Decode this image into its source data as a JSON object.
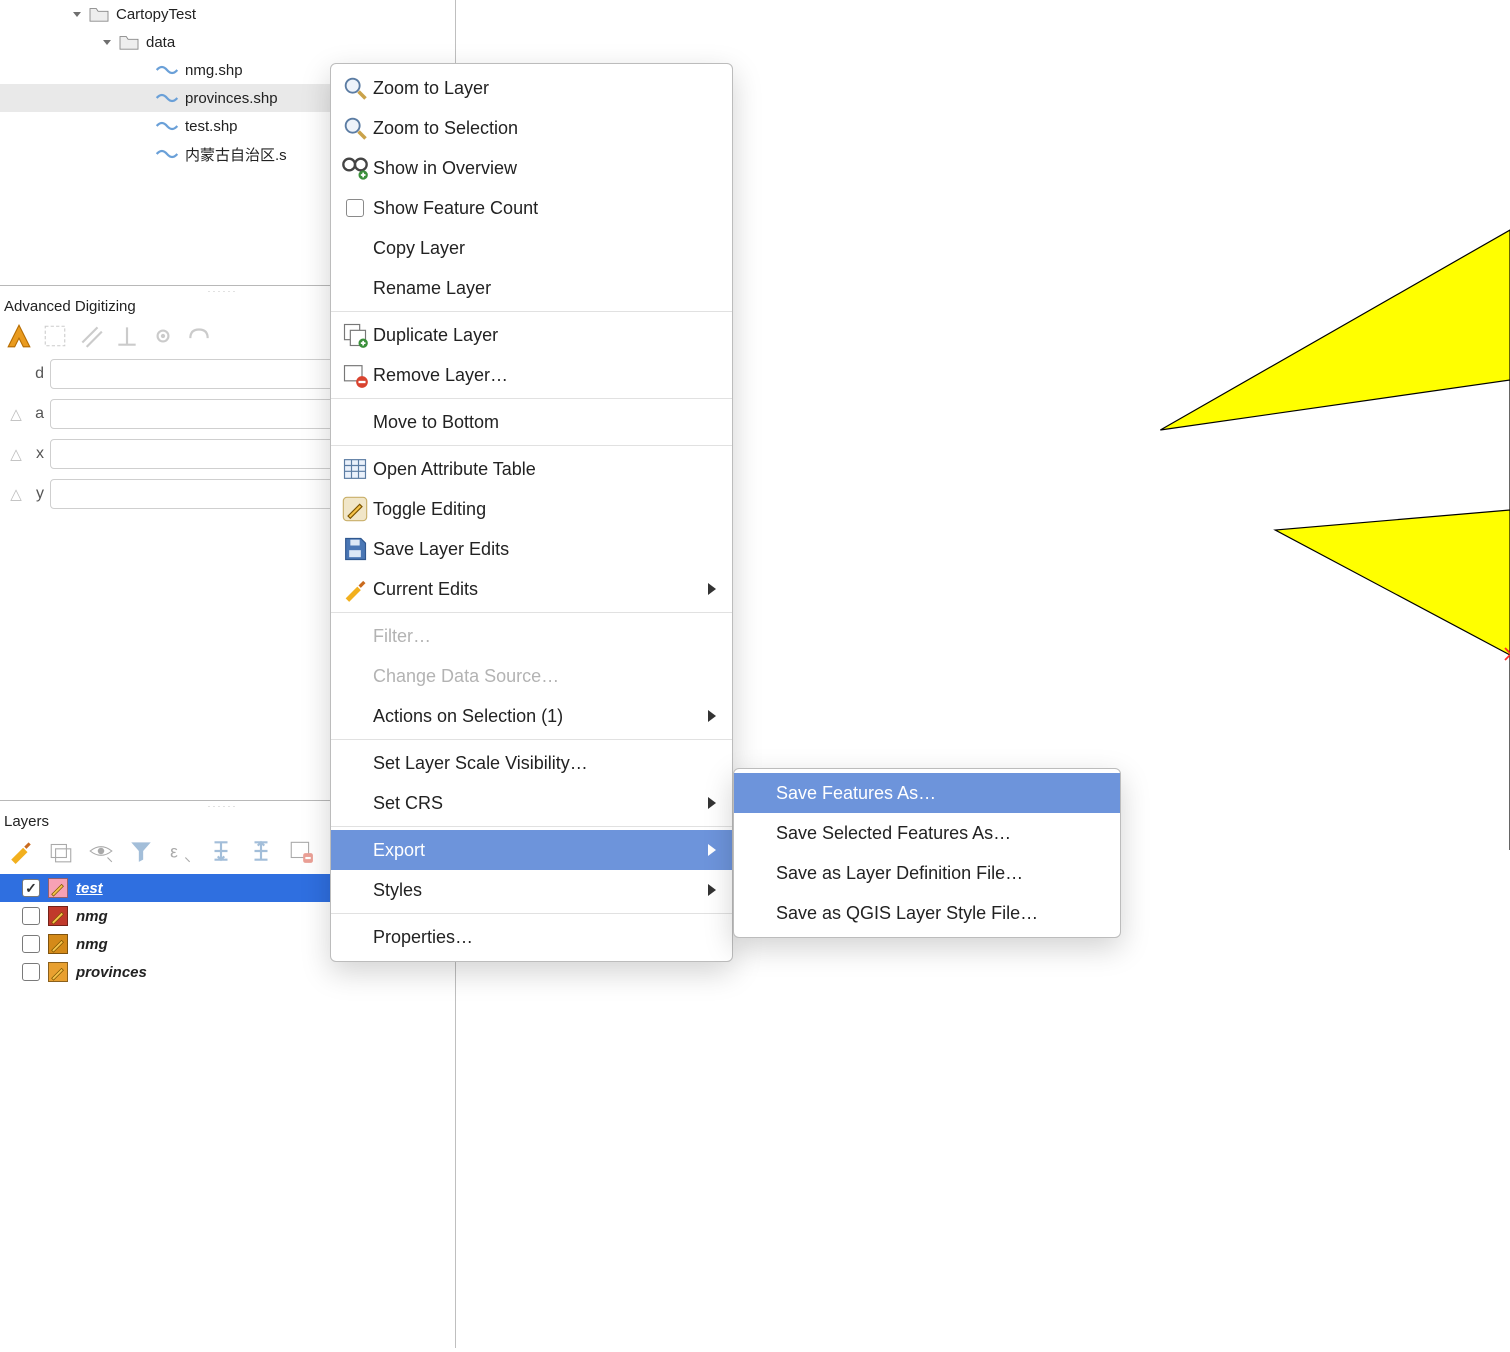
{
  "browser": {
    "items": [
      {
        "indent": 70,
        "kind": "folder",
        "name": "CartopyTest",
        "expanded": true
      },
      {
        "indent": 100,
        "kind": "folder",
        "name": "data",
        "expanded": true
      },
      {
        "indent": 155,
        "kind": "shp",
        "name": "nmg.shp"
      },
      {
        "indent": 155,
        "kind": "shp",
        "name": "provinces.shp",
        "selected": true
      },
      {
        "indent": 155,
        "kind": "shp",
        "name": "test.shp"
      },
      {
        "indent": 155,
        "kind": "shp",
        "name": "内蒙古自治区.shp",
        "truncated": "内蒙古自治区.s"
      }
    ]
  },
  "adv": {
    "title": "Advanced Digitizing",
    "rows": [
      {
        "label": "d",
        "value": "",
        "lock": false
      },
      {
        "label": "a",
        "value": "",
        "lock": true
      },
      {
        "label": "x",
        "value": "",
        "lock": true
      },
      {
        "label": "y",
        "value": "",
        "lock": true
      }
    ]
  },
  "layers": {
    "title": "Layers",
    "items": [
      {
        "name": "test",
        "checked": true,
        "selected": true,
        "fill": "#f7a1b4"
      },
      {
        "name": "nmg",
        "checked": false,
        "selected": false,
        "fill": "#c1392b"
      },
      {
        "name": "nmg",
        "checked": false,
        "selected": false,
        "fill": "#d48a19"
      },
      {
        "name": "provinces",
        "checked": false,
        "selected": false,
        "fill": "#e8a030"
      }
    ]
  },
  "menu": {
    "items": [
      {
        "icon": "zoom-layer",
        "label": "Zoom to Layer"
      },
      {
        "icon": "zoom-select",
        "label": "Zoom to Selection"
      },
      {
        "icon": "overview",
        "label": "Show in Overview"
      },
      {
        "icon": "checkbox",
        "label": "Show Feature Count"
      },
      {
        "icon": "",
        "label": "Copy Layer"
      },
      {
        "icon": "",
        "label": "Rename Layer"
      },
      {
        "sep": true
      },
      {
        "icon": "duplicate",
        "label": "Duplicate Layer"
      },
      {
        "icon": "remove",
        "label": "Remove Layer…"
      },
      {
        "sep": true
      },
      {
        "icon": "",
        "label": "Move to Bottom"
      },
      {
        "sep": true
      },
      {
        "icon": "table",
        "label": "Open Attribute Table"
      },
      {
        "icon": "edit-toggle",
        "label": "Toggle Editing"
      },
      {
        "icon": "save",
        "label": "Save Layer Edits"
      },
      {
        "icon": "current-edits",
        "label": "Current Edits",
        "submenu": true
      },
      {
        "sep": true
      },
      {
        "icon": "",
        "label": "Filter…",
        "disabled": true
      },
      {
        "icon": "",
        "label": "Change Data Source…",
        "disabled": true
      },
      {
        "icon": "",
        "label": "Actions on Selection (1)",
        "submenu": true
      },
      {
        "sep": true
      },
      {
        "icon": "",
        "label": "Set Layer Scale Visibility…"
      },
      {
        "icon": "",
        "label": "Set CRS",
        "submenu": true
      },
      {
        "sep": true
      },
      {
        "icon": "",
        "label": "Export",
        "submenu": true,
        "highlight": true
      },
      {
        "icon": "",
        "label": "Styles",
        "submenu": true
      },
      {
        "sep": true
      },
      {
        "icon": "",
        "label": "Properties…"
      }
    ],
    "sub": [
      {
        "label": "Save Features As…",
        "highlight": true
      },
      {
        "label": "Save Selected Features As…"
      },
      {
        "label": "Save as Layer Definition File…"
      },
      {
        "label": "Save as QGIS Layer Style File…"
      }
    ]
  }
}
